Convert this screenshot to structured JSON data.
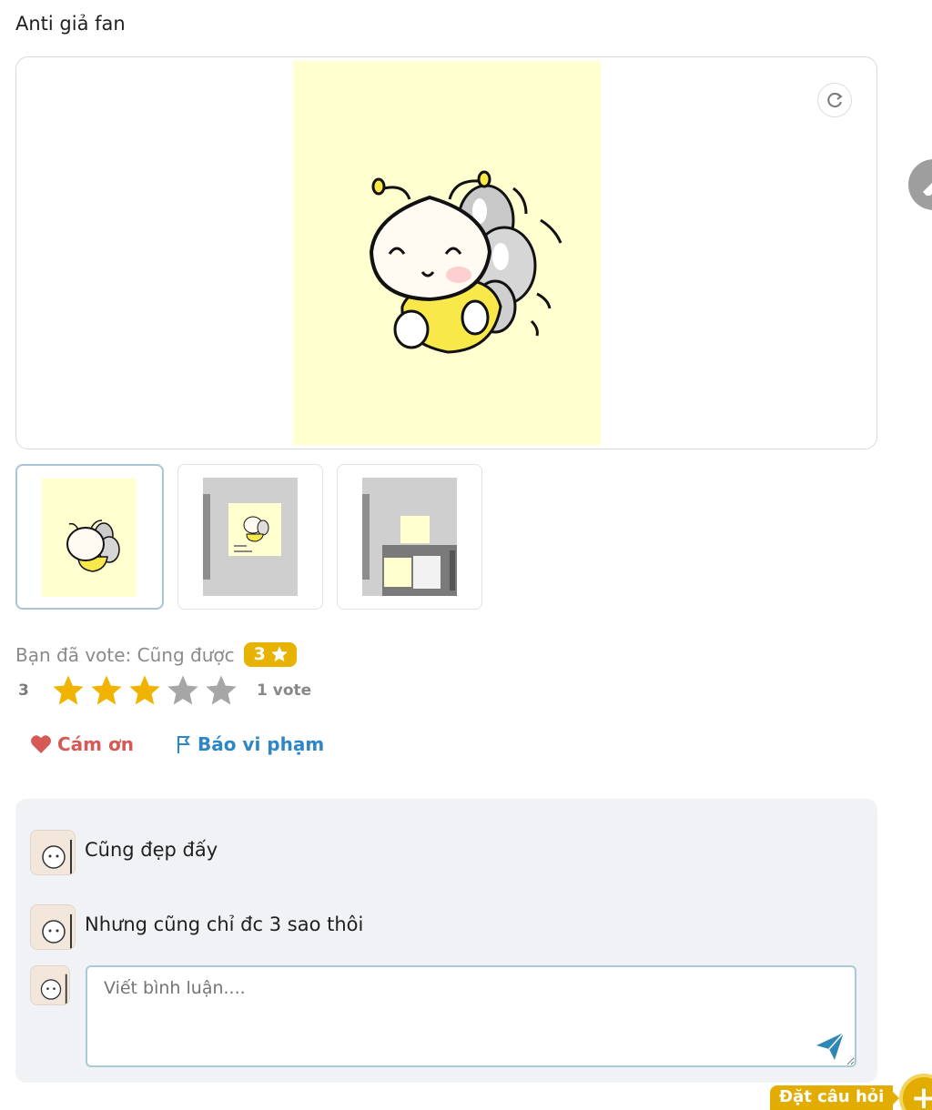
{
  "post": {
    "title": "Anti giả fan"
  },
  "viewer": {
    "rotate_icon": "rotate-icon",
    "art_bg": "#ffffcf"
  },
  "thumbnails": [
    {
      "name": "bee-drawing",
      "active": true
    },
    {
      "name": "app-screenshot-1",
      "active": false
    },
    {
      "name": "app-screenshot-2",
      "active": false
    }
  ],
  "vote": {
    "label": "Bạn đã vote: Cũng được",
    "badge_value": "3",
    "rating_value": "3",
    "stars_filled": 3,
    "stars_total": 5,
    "count_label": "1 vote",
    "star_color": "#f0b400",
    "star_empty_color": "#a6a6a6"
  },
  "actions": {
    "thank_label": "Cám ơn",
    "report_label": "Báo vi phạm"
  },
  "comments": [
    {
      "text": "Cũng đẹp đấy"
    },
    {
      "text": "Nhưng cũng chỉ đc 3 sao thôi"
    }
  ],
  "composer": {
    "placeholder": "Viết bình luận...."
  },
  "floating": {
    "ask_label": "Đặt câu hỏi",
    "plus_label": "+"
  }
}
